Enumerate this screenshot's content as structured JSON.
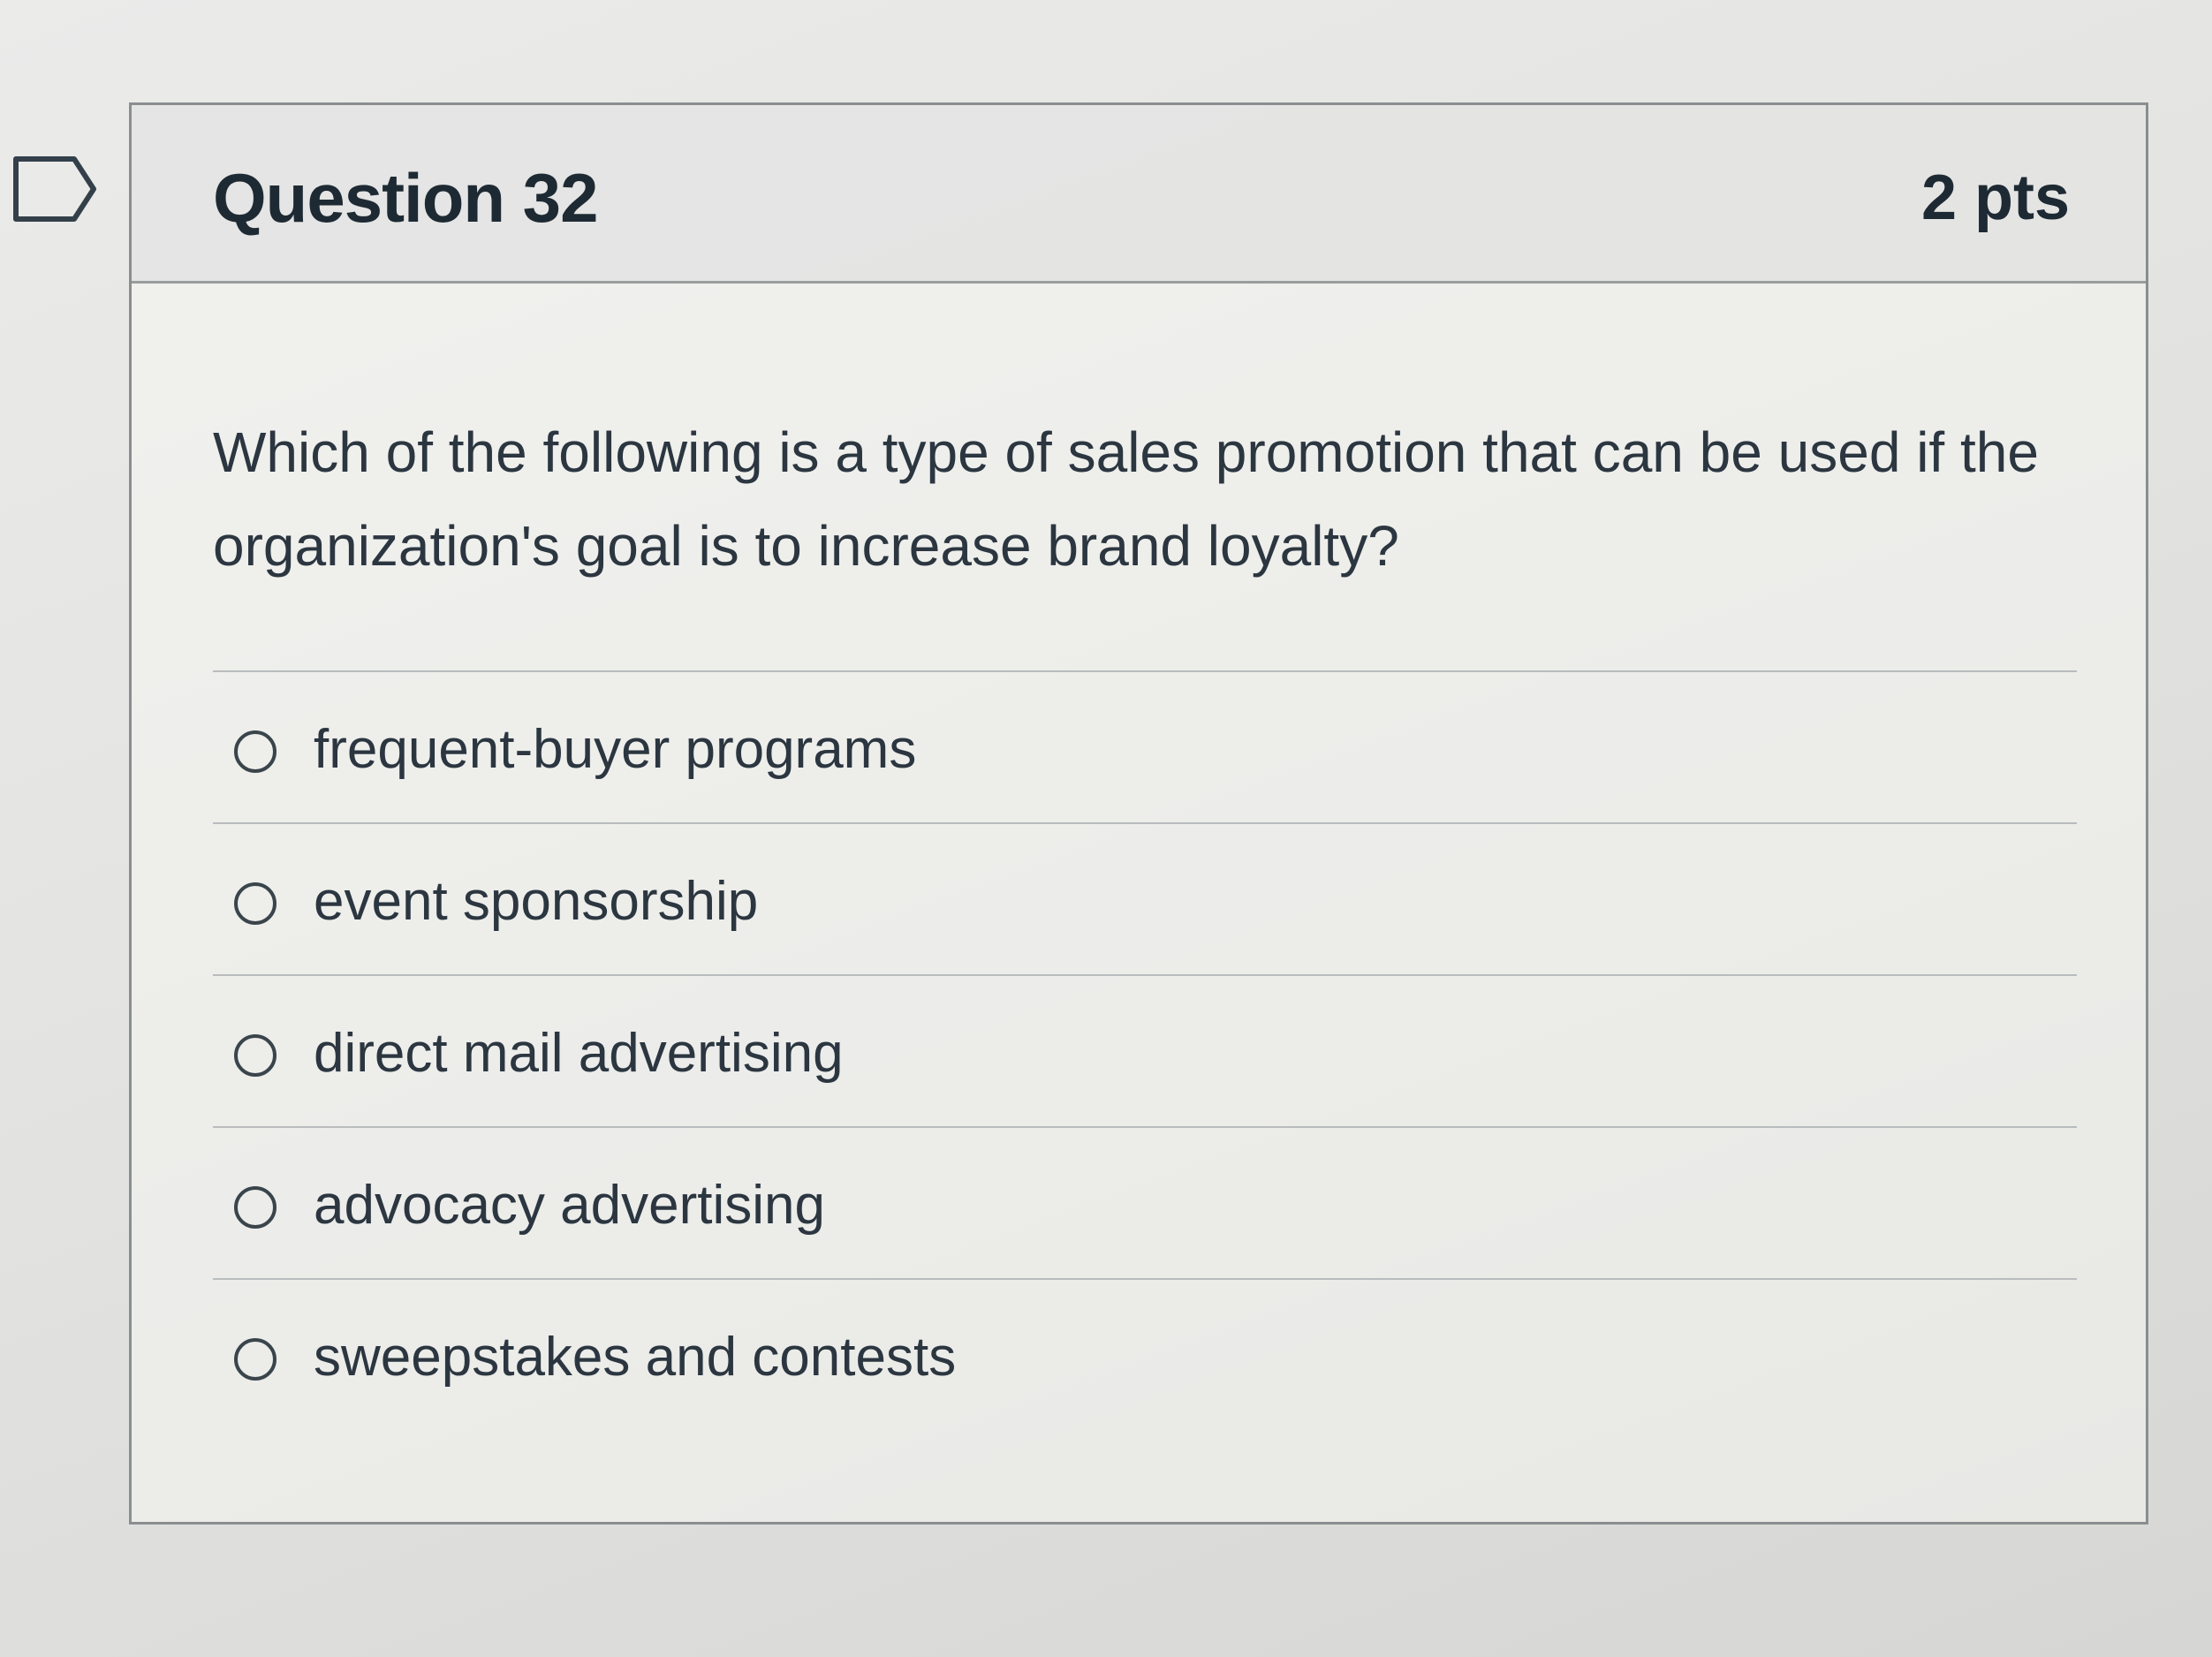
{
  "question": {
    "title": "Question 32",
    "points": "2 pts",
    "flag_icon": "flag-outline-icon",
    "text": "Which of the following is a type of sales promotion that can be used if the organization's goal is to increase brand loyalty?",
    "answers": [
      {
        "label": "frequent-buyer programs",
        "selected": false
      },
      {
        "label": "event sponsorship",
        "selected": false
      },
      {
        "label": "direct mail advertising",
        "selected": false
      },
      {
        "label": "advocacy advertising",
        "selected": false
      },
      {
        "label": "sweepstakes and contests",
        "selected": false
      }
    ]
  },
  "colors": {
    "text": "#2d3b45",
    "border": "#8a8e90",
    "header_bg": "#e2e3e2"
  }
}
